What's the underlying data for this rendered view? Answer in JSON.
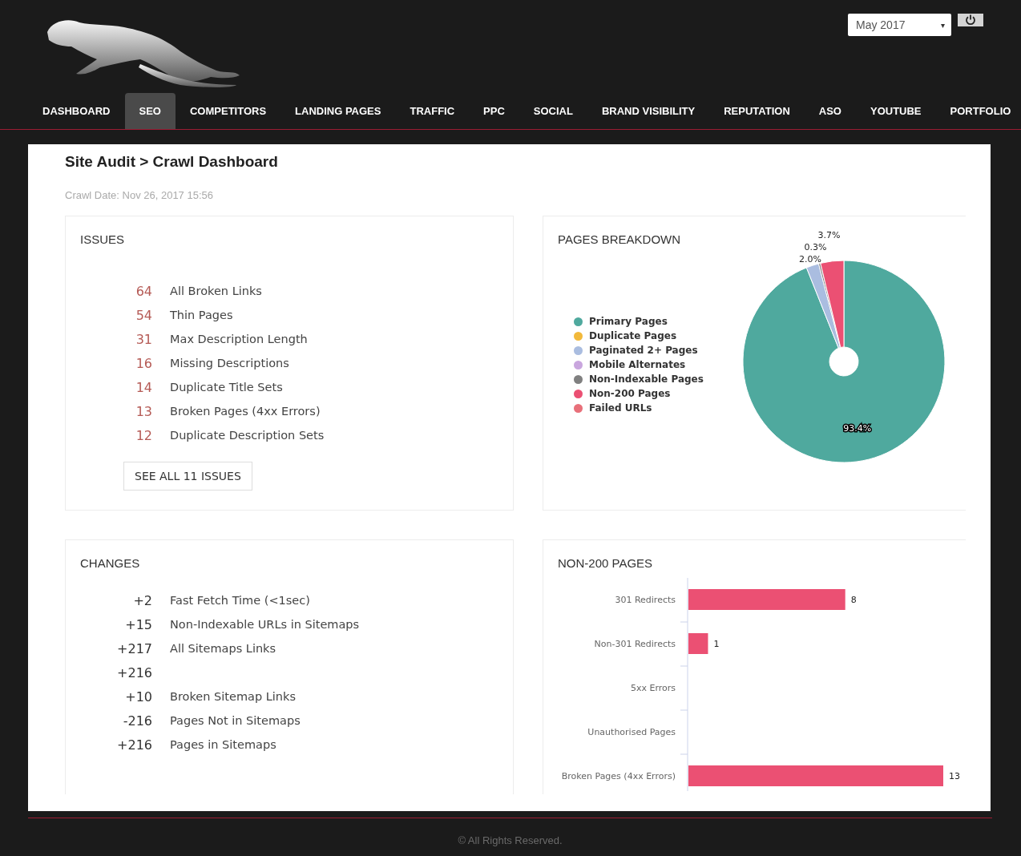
{
  "header": {
    "date_select": {
      "value": "May 2017",
      "caret": "▾"
    }
  },
  "nav": [
    {
      "label": "DASHBOARD",
      "selected": false
    },
    {
      "label": "SEO",
      "selected": true
    },
    {
      "label": "COMPETITORS",
      "selected": false
    },
    {
      "label": "LANDING PAGES",
      "selected": false
    },
    {
      "label": "TRAFFIC",
      "selected": false
    },
    {
      "label": "PPC",
      "selected": false
    },
    {
      "label": "SOCIAL",
      "selected": false
    },
    {
      "label": "BRAND VISIBILITY",
      "selected": false
    },
    {
      "label": "REPUTATION",
      "selected": false
    },
    {
      "label": "ASO",
      "selected": false
    },
    {
      "label": "YOUTUBE",
      "selected": false
    },
    {
      "label": "PORTFOLIO",
      "selected": false
    }
  ],
  "breadcrumb": "Site Audit > Crawl Dashboard",
  "crawl_date": "Crawl Date: Nov 26, 2017 15:56",
  "issues": {
    "title": "ISSUES",
    "items": [
      {
        "count": "64",
        "label": "All Broken Links"
      },
      {
        "count": "54",
        "label": "Thin Pages"
      },
      {
        "count": "31",
        "label": "Max Description Length"
      },
      {
        "count": "16",
        "label": "Missing Descriptions"
      },
      {
        "count": "14",
        "label": "Duplicate Title Sets"
      },
      {
        "count": "13",
        "label": "Broken Pages (4xx Errors)"
      },
      {
        "count": "12",
        "label": "Duplicate Description Sets"
      }
    ],
    "button": "SEE ALL 11 ISSUES"
  },
  "pages_breakdown": {
    "title": "PAGES BREAKDOWN",
    "legend": [
      {
        "color": "#4fa99e"
      },
      {
        "color": "#f2b93b"
      },
      {
        "color": "#aabde0"
      },
      {
        "color": "#c9a6de"
      },
      {
        "color": "#808080"
      },
      {
        "color": "#eb5073"
      },
      {
        "color": "#e8707a"
      }
    ],
    "chart_data": {
      "type": "donut",
      "categories": [
        "Primary Pages",
        "Duplicate Pages",
        "Paginated 2+ Pages",
        "Mobile Alternates",
        "Non-Indexable Pages",
        "Non-200 Pages",
        "Failed URLs"
      ],
      "values": [
        93.4,
        0,
        2.0,
        0,
        0.3,
        3.7,
        0
      ],
      "value_labels": [
        "93.4%",
        null,
        "2.0%",
        null,
        "0.3%",
        "3.7%",
        null
      ]
    }
  },
  "changes": {
    "title": "CHANGES",
    "items": [
      {
        "delta": "+2",
        "label": "Fast Fetch Time (<1sec)"
      },
      {
        "delta": "+15",
        "label": "Non-Indexable URLs in Sitemaps"
      },
      {
        "delta": "+217",
        "label": "All Sitemaps Links"
      },
      {
        "delta": "+216"
      },
      {
        "delta": "+10",
        "label": "Broken Sitemap Links"
      },
      {
        "delta": "-216",
        "label": "Pages Not in Sitemaps"
      },
      {
        "delta": "+216",
        "label": "Pages in Sitemaps"
      }
    ]
  },
  "non200": {
    "title": "NON-200 PAGES",
    "chart_data": {
      "type": "bar",
      "orientation": "horizontal",
      "categories": [
        "301 Redirects",
        "Non-301 Redirects",
        "5xx Errors",
        "Unauthorised Pages",
        "Broken Pages (4xx Errors)"
      ],
      "series": [
        {
          "color": "#eb5073",
          "values": [
            8,
            1,
            null,
            null,
            13
          ]
        }
      ],
      "data_labels": true
    }
  },
  "footer": "© All Rights Reserved."
}
